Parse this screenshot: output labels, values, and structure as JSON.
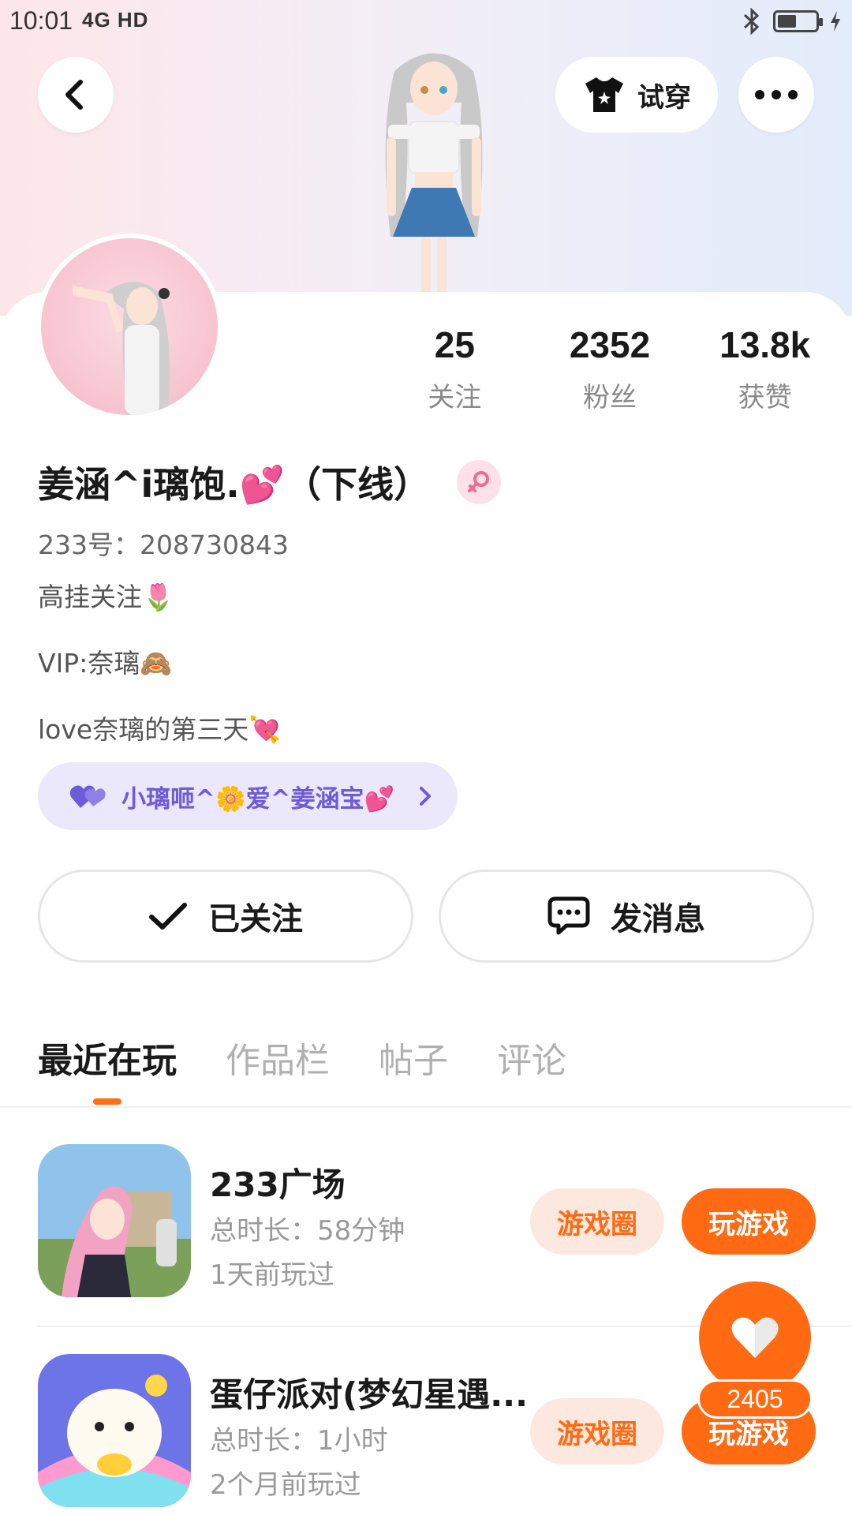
{
  "status_bar": {
    "time": "10:01",
    "network": "4G HD"
  },
  "header": {
    "tryon_label": "试穿"
  },
  "stats": [
    {
      "value": "25",
      "label": "关注"
    },
    {
      "value": "2352",
      "label": "粉丝"
    },
    {
      "value": "13.8k",
      "label": "获赞"
    }
  ],
  "profile": {
    "name": "姜涵^i璃饱.💕（下线）",
    "id_line": "233号：208730843",
    "bio": [
      "高挂关注🌷",
      "VIP:奈璃🙈",
      "love奈璃的第三天💘"
    ],
    "couple_tag": "小璃咂^🌼爱^姜涵宝💕"
  },
  "actions": {
    "follow_label": "已关注",
    "message_label": "发消息"
  },
  "tabs": [
    "最近在玩",
    "作品栏",
    "帖子",
    "评论"
  ],
  "games": [
    {
      "title": "233广场",
      "duration": "总时长：58分钟",
      "last_played": "1天前玩过",
      "circle_label": "游戏圈",
      "play_label": "玩游戏"
    },
    {
      "title": "蛋仔派对(梦幻星遇...",
      "duration": "总时长：1小时",
      "last_played": "2个月前玩过",
      "circle_label": "游戏圈",
      "play_label": "玩游戏"
    }
  ],
  "like": {
    "count": "2405"
  },
  "colors": {
    "accent": "#ff6a12",
    "couple_purple": "#6e5bd8",
    "gender_pink": "#f06a90"
  }
}
